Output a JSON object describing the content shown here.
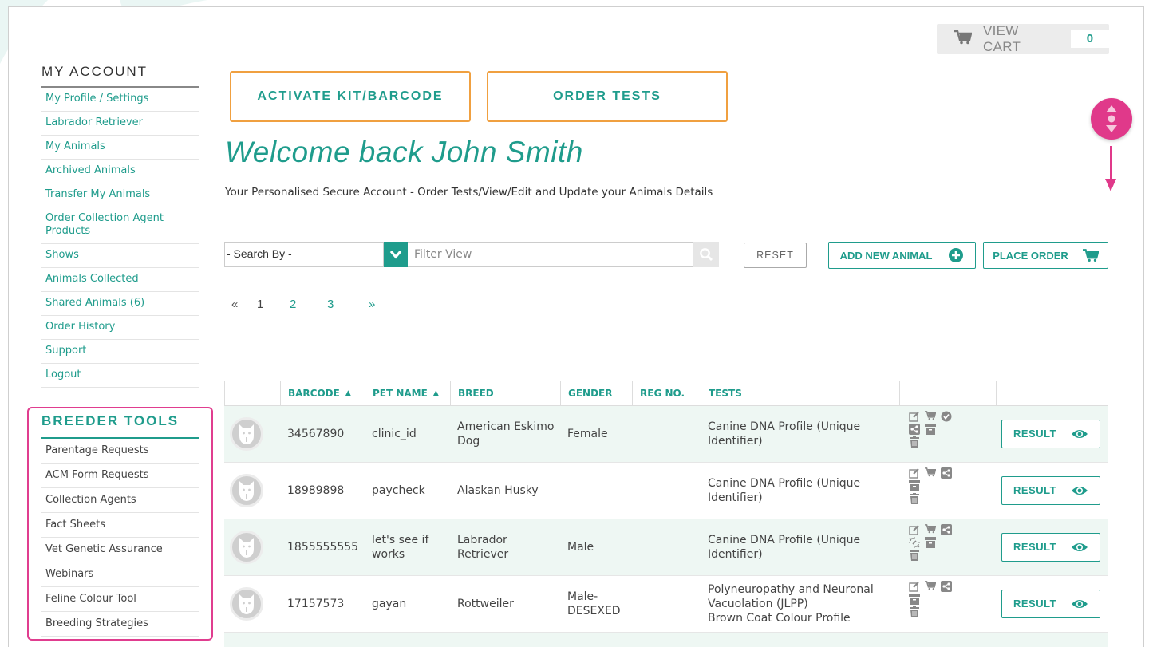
{
  "cart": {
    "label": "VIEW CART",
    "count": "0"
  },
  "sidebar": {
    "heading": "MY ACCOUNT",
    "items": [
      "My Profile / Settings",
      "Labrador Retriever",
      "My Animals",
      "Archived Animals",
      "Transfer My Animals",
      "Order Collection Agent Products",
      "Shows",
      "Animals Collected",
      "Shared Animals (6)",
      "Order History",
      "Support",
      "Logout"
    ]
  },
  "breeder_tools": {
    "heading": "BREEDER TOOLS",
    "items": [
      "Parentage Requests",
      "ACM Form Requests",
      "Collection Agents",
      "Fact Sheets",
      "Vet Genetic Assurance",
      "Webinars",
      "Feline Colour Tool",
      "Breeding Strategies"
    ]
  },
  "actions": {
    "activate": "ACTIVATE KIT/BARCODE",
    "order": "ORDER TESTS"
  },
  "welcome": {
    "title": "Welcome back John Smith",
    "subtitle": "Your Personalised Secure Account - Order Tests/View/Edit and Update your Animals Details"
  },
  "search": {
    "select_label": "- Search By -",
    "placeholder": "Filter View",
    "reset": "RESET",
    "add_animal": "ADD NEW ANIMAL",
    "place_order": "PLACE ORDER"
  },
  "pager": {
    "prev": "«",
    "pages": [
      "1",
      "2",
      "3"
    ],
    "next": "»"
  },
  "table": {
    "columns": [
      "",
      "BARCODE",
      "PET NAME",
      "BREED",
      "GENDER",
      "REG NO.",
      "TESTS",
      "",
      ""
    ],
    "result_label": "RESULT",
    "rows": [
      {
        "barcode": "34567890",
        "pet_name": "clinic_id",
        "breed": "American Eskimo Dog",
        "gender": "Female",
        "reg_no": "",
        "tests": "Canine DNA Profile (Unique Identifier)"
      },
      {
        "barcode": "18989898",
        "pet_name": "paycheck",
        "breed": "Alaskan Husky",
        "gender": "",
        "reg_no": "",
        "tests": "Canine DNA Profile (Unique Identifier)"
      },
      {
        "barcode": "1855555555",
        "pet_name": "let's see if works",
        "breed": "Labrador Retriever",
        "gender": "Male",
        "reg_no": "",
        "tests": "Canine DNA Profile (Unique Identifier)"
      },
      {
        "barcode": "17157573",
        "pet_name": "gayan",
        "breed": "Rottweiler",
        "gender": "Male-DESEXED",
        "reg_no": "",
        "tests": "Polyneuropathy and Neuronal Vacuolation (JLPP)\nBrown Coat Colour Profile"
      }
    ]
  },
  "colors": {
    "teal": "#1f9c8c",
    "orange": "#f0a040",
    "pink": "#e0398a"
  }
}
